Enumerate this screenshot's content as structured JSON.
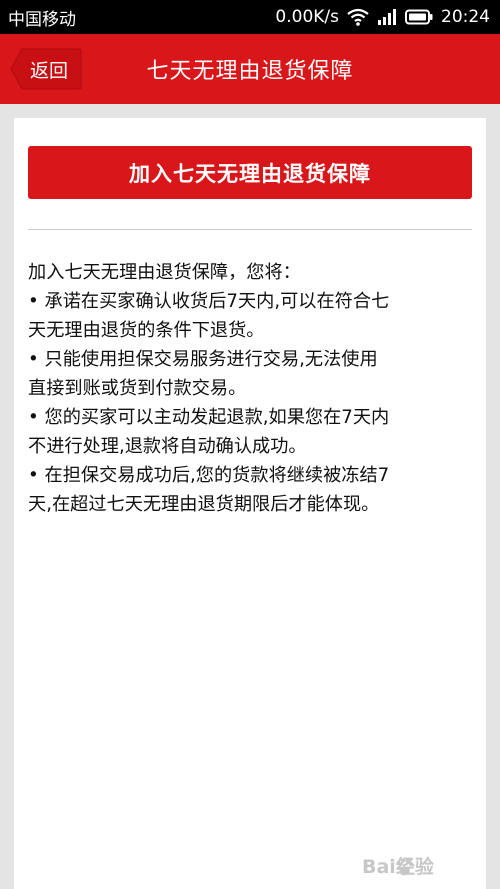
{
  "status_bar": {
    "carrier": "中国移动",
    "speed": "0.00K/s",
    "time": "20:24"
  },
  "title_bar": {
    "back_label": "返回",
    "title": "七天无理由退货保障"
  },
  "main": {
    "join_button_label": "加入七天无理由退货保障",
    "info_lines": [
      "加入七天无理由退货保障，您将：",
      "• 承诺在买家确认收货后7天内,可以在符合七",
      "天无理由退货的条件下退货。",
      "• 只能使用担保交易服务进行交易,无法使用",
      "直接到账或货到付款交易。",
      "• 您的买家可以主动发起退款,如果您在7天内",
      "不进行处理,退款将自动确认成功。",
      "• 在担保交易成功后,您的货款将继续被冻结7",
      "天,在超过七天无理由退货期限后才能体现。"
    ]
  },
  "watermark": {
    "text": "Bai经验"
  },
  "colors": {
    "accent": "#d9161a",
    "status_bar": "#000000",
    "page_bg": "#e4e4e4",
    "card_bg": "#ffffff"
  },
  "icons": [
    "wifi-icon",
    "signal-icon",
    "battery-icon",
    "paw-icon"
  ]
}
